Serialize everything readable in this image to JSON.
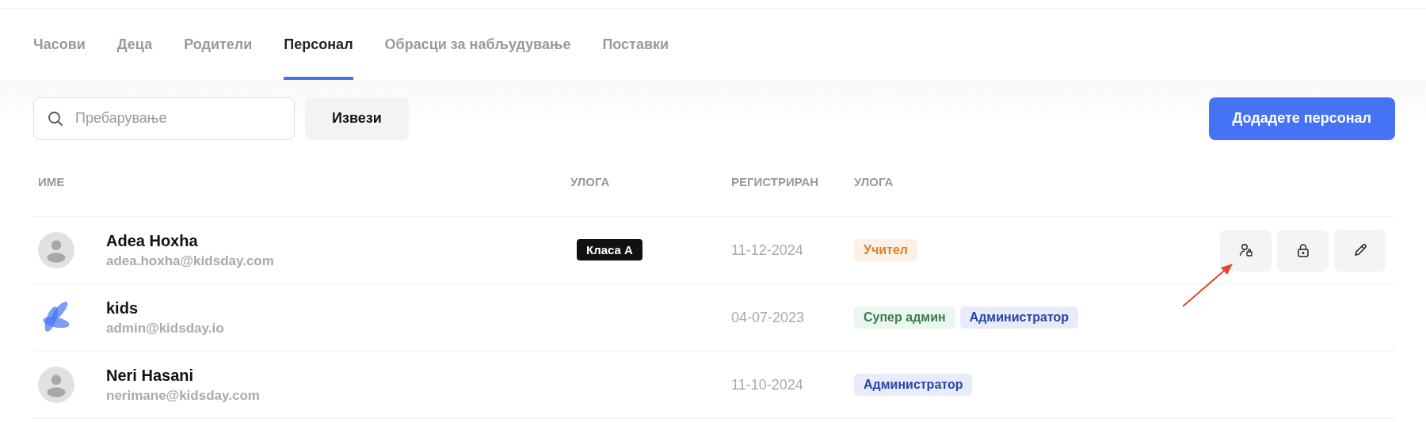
{
  "tabs": [
    {
      "label": "Часови",
      "selected": false
    },
    {
      "label": "Деца",
      "selected": false
    },
    {
      "label": "Родители",
      "selected": false
    },
    {
      "label": "Персонал",
      "selected": true
    },
    {
      "label": "Обрасци за набљудување",
      "selected": false
    },
    {
      "label": "Поставки",
      "selected": false
    }
  ],
  "search": {
    "placeholder": "Пребарување"
  },
  "export_button": "Извези",
  "add_button": "Додадете персонал",
  "table": {
    "columns": [
      "ИМЕ",
      "УЛОГА",
      "РЕГИСТРИРАН",
      "УЛОГА"
    ],
    "rows": [
      {
        "avatar": {
          "kind": "person"
        },
        "name": "Adea Hoxha",
        "email": "adea.hoxha@kidsday.com",
        "class": "Класа А",
        "registered": "11-12-2024",
        "roles": [
          {
            "label": "Учител",
            "kind": "teacher"
          }
        ],
        "actions": [
          {
            "kind": "permissions"
          },
          {
            "kind": "lock"
          },
          {
            "kind": "edit"
          }
        ]
      },
      {
        "avatar": {
          "kind": "logo"
        },
        "name": "kids",
        "email": "admin@kidsday.io",
        "registered": "04-07-2023",
        "roles": [
          {
            "label": "Супер админ",
            "kind": "superadmin"
          },
          {
            "label": "Администратор",
            "kind": "admin"
          }
        ]
      },
      {
        "avatar": {
          "kind": "person"
        },
        "name": "Neri Hasani",
        "email": "nerimane@kidsday.com",
        "registered": "11-10-2024",
        "roles": [
          {
            "label": "Администратор",
            "kind": "admin"
          }
        ]
      }
    ]
  }
}
